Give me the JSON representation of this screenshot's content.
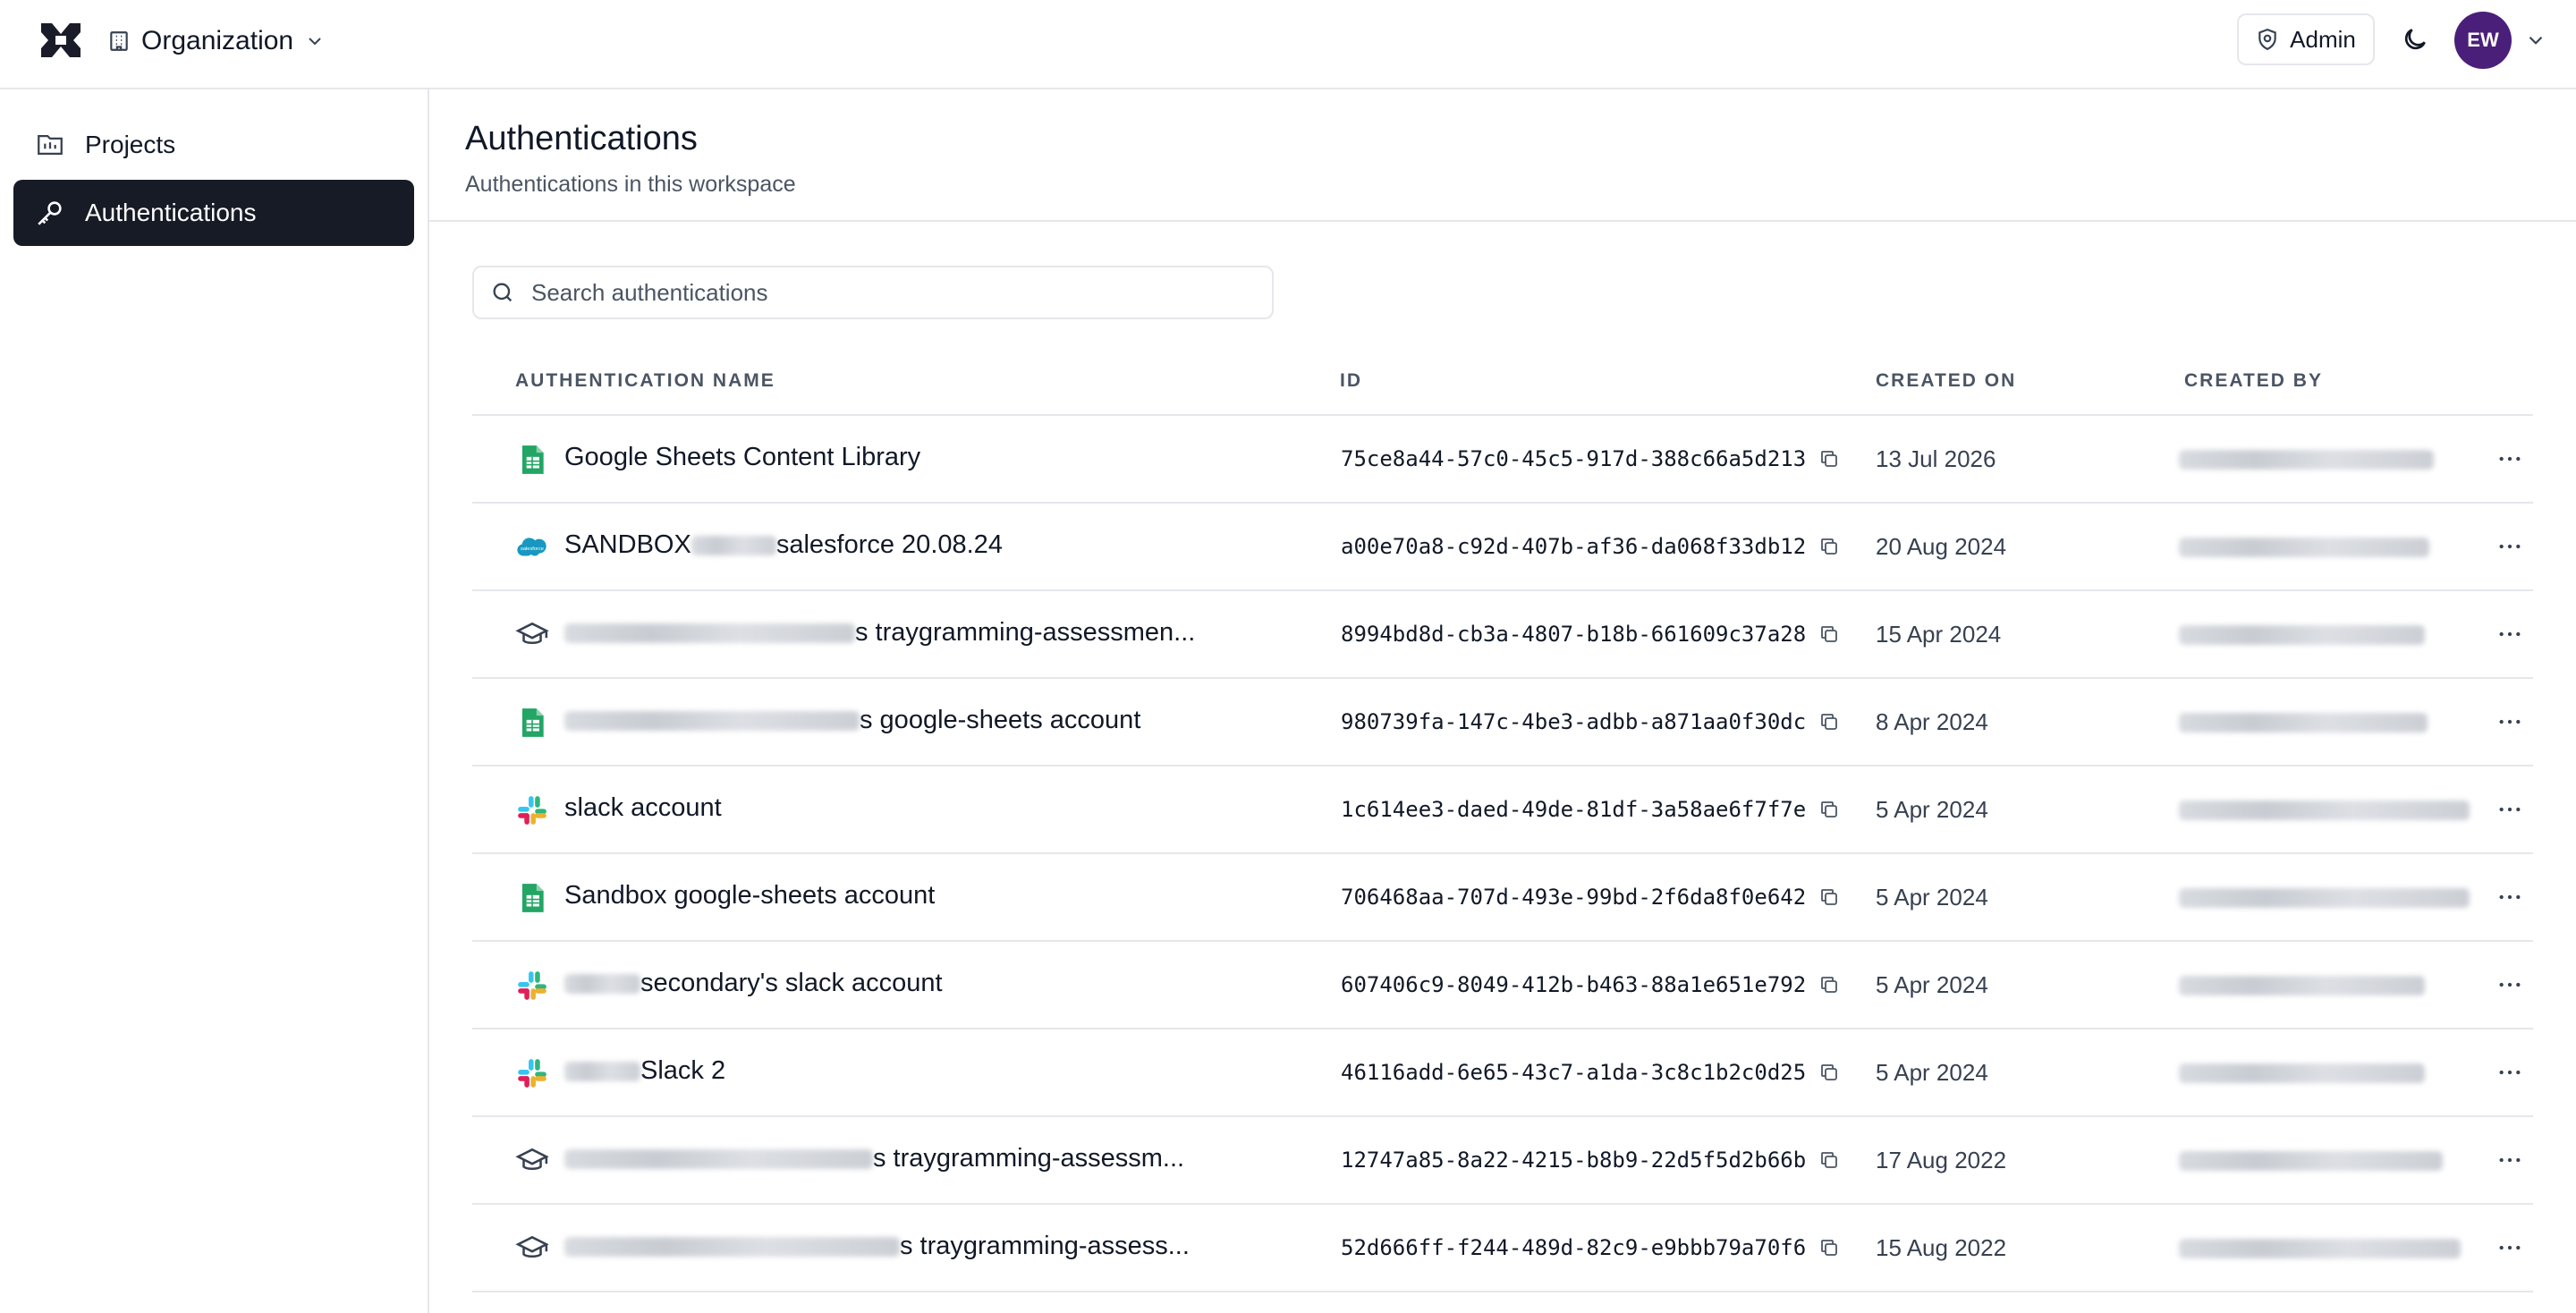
{
  "header": {
    "org_label": "Organization",
    "admin_label": "Admin",
    "avatar_initials": "EW"
  },
  "sidebar": {
    "items": [
      {
        "label": "Projects"
      },
      {
        "label": "Authentications"
      }
    ]
  },
  "page": {
    "title": "Authentications",
    "subtitle": "Authentications in this workspace"
  },
  "search": {
    "placeholder": "Search authentications"
  },
  "table": {
    "headers": [
      "AUTHENTICATION NAME",
      "ID",
      "CREATED ON",
      "CREATED BY"
    ],
    "rows": [
      {
        "icon": "google-sheets-icon",
        "name_prefix": "",
        "name": "Google Sheets Content Library",
        "id": "75ce8a44-57c0-45c5-917d-388c66a5d213",
        "created": "13 Jul 2026"
      },
      {
        "icon": "salesforce-icon",
        "name_prefix": "SANDBOX",
        "name": "salesforce 20.08.24",
        "id": "a00e70a8-c92d-407b-af36-da068f33db12",
        "created": "20 Aug 2024"
      },
      {
        "icon": "graduation-cap-icon",
        "name_prefix": "",
        "name": "s traygramming-assessmen...",
        "id": "8994bd8d-cb3a-4807-b18b-661609c37a28",
        "created": "15 Apr 2024"
      },
      {
        "icon": "google-sheets-icon",
        "name_prefix": "",
        "name": "s google-sheets account",
        "id": "980739fa-147c-4be3-adbb-a871aa0f30dc",
        "created": "8 Apr 2024"
      },
      {
        "icon": "slack-icon",
        "name_prefix": "",
        "name": "slack account",
        "id": "1c614ee3-daed-49de-81df-3a58ae6f7f7e",
        "created": "5 Apr 2024"
      },
      {
        "icon": "google-sheets-icon",
        "name_prefix": "",
        "name": "Sandbox google-sheets account",
        "id": "706468aa-707d-493e-99bd-2f6da8f0e642",
        "created": "5 Apr 2024"
      },
      {
        "icon": "slack-icon",
        "name_prefix": "",
        "name": "secondary's slack account",
        "id": "607406c9-8049-412b-b463-88a1e651e792",
        "created": "5 Apr 2024"
      },
      {
        "icon": "slack-icon",
        "name_prefix": "",
        "name": "Slack 2",
        "id": "46116add-6e65-43c7-a1da-3c8c1b2c0d25",
        "created": "5 Apr 2024"
      },
      {
        "icon": "graduation-cap-icon",
        "name_prefix": "",
        "name": "s traygramming-assessm...",
        "id": "12747a85-8a22-4215-b8b9-22d5f5d2b66b",
        "created": "17 Aug 2022"
      },
      {
        "icon": "graduation-cap-icon",
        "name_prefix": "",
        "name": "s traygramming-assess...",
        "id": "52d666ff-f244-489d-82c9-e9bbb79a70f6",
        "created": "15 Aug 2022"
      }
    ]
  },
  "colors": {
    "active_nav_bg": "#171b26",
    "avatar_bg": "#4a1f7a",
    "sheets_green": "#22a565",
    "salesforce_blue": "#1798c1"
  }
}
